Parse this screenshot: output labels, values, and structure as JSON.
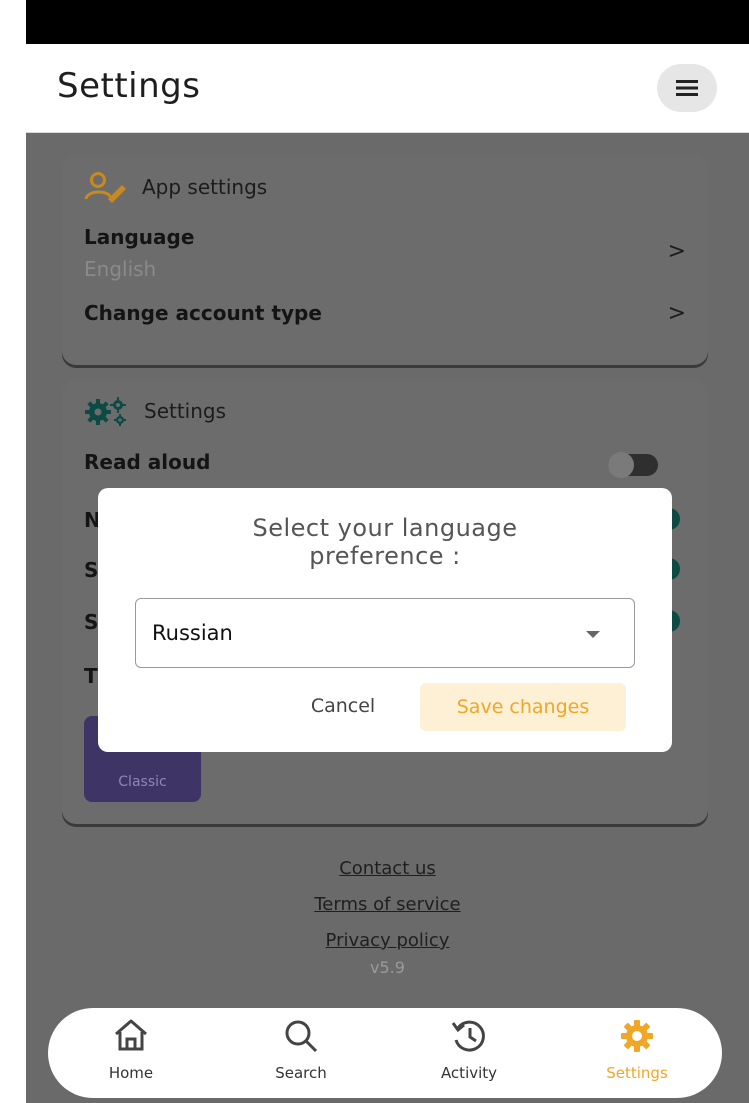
{
  "header": {
    "title": "Settings",
    "menu_icon": "hamburger-icon"
  },
  "app_settings": {
    "title": "App settings",
    "icon": "user-edit-icon",
    "language": {
      "label": "Language",
      "value": "English"
    },
    "account": {
      "label": "Change account type"
    }
  },
  "settings": {
    "title": "Settings",
    "icon": "gears-icon",
    "read_aloud": {
      "label": "Read aloud",
      "on": false
    },
    "partial_rows": [
      "N",
      "S",
      "S",
      "T"
    ],
    "theme_tile": {
      "label": "Classic"
    }
  },
  "links": {
    "contact": "Contact us",
    "terms": "Terms of service",
    "privacy": "Privacy policy",
    "version": "v5.9"
  },
  "modal": {
    "title_line1": "Select your language",
    "title_line2": "preference :",
    "selected": "Russian",
    "cancel": "Cancel",
    "save": "Save changes"
  },
  "nav": [
    {
      "label": "Home",
      "icon": "home-icon"
    },
    {
      "label": "Search",
      "icon": "search-icon"
    },
    {
      "label": "Activity",
      "icon": "history-icon"
    },
    {
      "label": "Settings",
      "icon": "gear-icon",
      "active": true
    }
  ],
  "colors": {
    "accent": "#f0a627",
    "accent_bg": "#fdf0d4",
    "toggle_on": "#0d4a44",
    "tile": "#3e3466"
  }
}
